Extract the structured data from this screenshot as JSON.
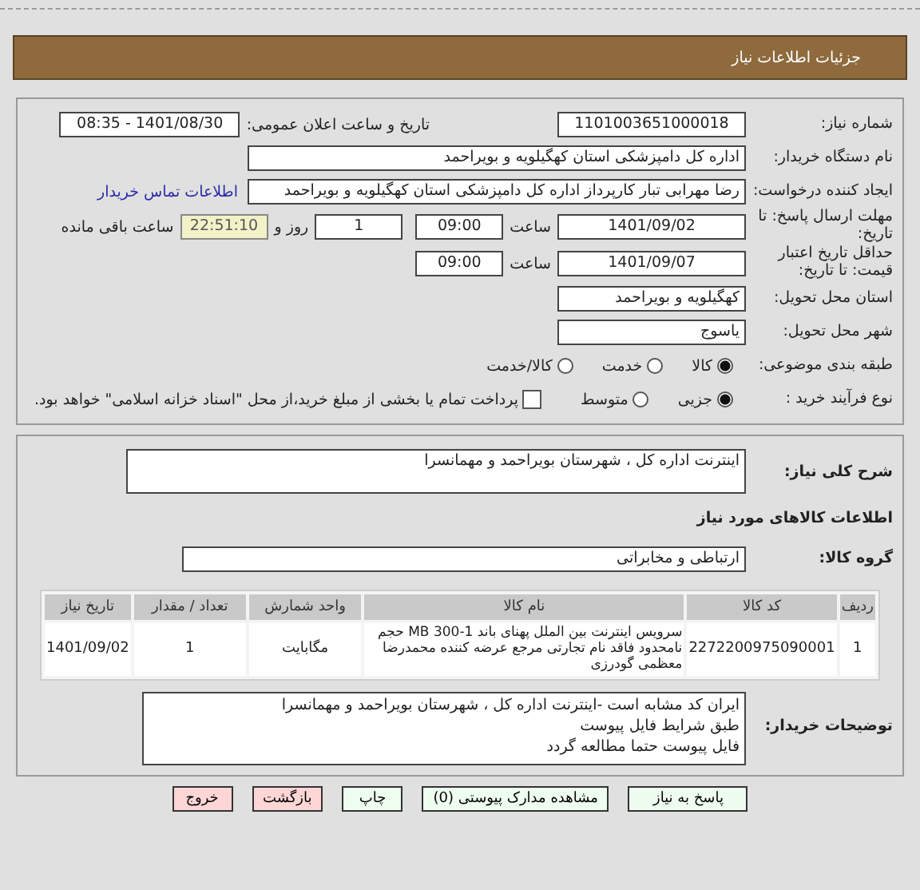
{
  "header": {
    "title": "جزئیات اطلاعات نیاز"
  },
  "need_number": {
    "label": "شماره نیاز:",
    "value": "1101003651000018"
  },
  "announce": {
    "label": "تاریخ و ساعت اعلان عمومی:",
    "value": "1401/08/30 - 08:35"
  },
  "buyer": {
    "label": "نام دستگاه خریدار:",
    "value": "اداره کل دامپزشکی استان کهگیلویه و بویراحمد"
  },
  "requester": {
    "label": "ایجاد کننده درخواست:",
    "value": "رضا مهرابی تبار کارپرداز اداره کل دامپزشکی استان کهگیلویه و بویراحمد",
    "link": "اطلاعات تماس خریدار"
  },
  "deadline": {
    "label": "مهلت ارسال پاسخ: تا تاریخ:",
    "date": "1401/09/02",
    "time_label": "ساعت",
    "time": "09:00",
    "days": "1",
    "days_label": "روز و",
    "remaining": "22:51:10",
    "remaining_label": "ساعت باقی مانده"
  },
  "validity": {
    "label": "حداقل تاریخ اعتبار قیمت: تا تاریخ:",
    "date": "1401/09/07",
    "time_label": "ساعت",
    "time": "09:00"
  },
  "province": {
    "label": "استان محل تحویل:",
    "value": "کهگیلویه و بویراحمد"
  },
  "city": {
    "label": "شهر محل تحویل:",
    "value": "یاسوج"
  },
  "category": {
    "label": "طبقه بندی موضوعی:",
    "options": [
      {
        "label": "کالا",
        "selected": true
      },
      {
        "label": "خدمت",
        "selected": false
      },
      {
        "label": "کالا/خدمت",
        "selected": false
      }
    ]
  },
  "process": {
    "label": "نوع فرآیند خرید :",
    "options": [
      {
        "label": "جزیی",
        "selected": true
      },
      {
        "label": "متوسط",
        "selected": false
      }
    ],
    "checkbox": {
      "label": "پرداخت تمام یا بخشی از مبلغ خرید،از محل \"اسناد خزانه اسلامی\" خواهد بود.",
      "checked": false
    }
  },
  "description": {
    "label": "شرح کلی نیاز:",
    "value": "اینترنت اداره کل ، شهرستان بویراحمد و مهمانسرا"
  },
  "goods_heading": "اطلاعات کالاهای مورد نیاز",
  "goods_group": {
    "label": "گروه کالا:",
    "value": "ارتباطی و مخابراتی"
  },
  "table": {
    "columns": [
      "ردیف",
      "کد کالا",
      "نام کالا",
      "واحد شمارش",
      "تعداد / مقدار",
      "تاریخ نیاز"
    ],
    "rows": [
      [
        "1",
        "2272200975090001",
        "سرویس اینترنت بین الملل پهنای باند 1-300 MB حجم نامحدود فاقد نام تجارتی مرجع عرضه کننده محمدرضا معظمی گودرزی",
        "مگابایت",
        "1",
        "1401/09/02"
      ]
    ]
  },
  "notes": {
    "label": "توضیحات خریدار:",
    "lines": [
      "ایران کد مشابه است -اینترنت اداره کل ، شهرستان بویراحمد و مهمانسرا",
      "طبق شرایط فایل پیوست",
      "فایل پیوست حتما مطالعه گردد"
    ]
  },
  "buttons": [
    {
      "label": "پاسخ به نیاز",
      "kind": "primary"
    },
    {
      "label": "مشاهده مدارک پیوستی (0)",
      "kind": "primary"
    },
    {
      "label": "چاپ",
      "kind": "primary"
    },
    {
      "label": "بازگشت",
      "kind": "danger"
    },
    {
      "label": "خروج",
      "kind": "danger"
    }
  ]
}
